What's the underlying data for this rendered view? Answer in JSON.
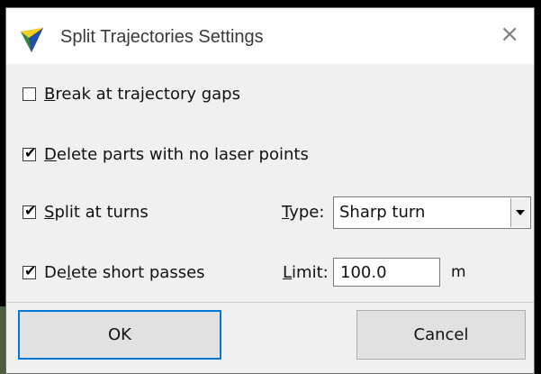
{
  "window": {
    "title": "Split Trajectories Settings",
    "close_glyph": "×",
    "icon": "app-logo-icon"
  },
  "options": [
    {
      "pre": "",
      "mnemonic": "B",
      "post": "reak at trajectory gaps",
      "checked": false
    },
    {
      "pre": "",
      "mnemonic": "D",
      "post": "elete parts with no laser points",
      "checked": true
    },
    {
      "pre": "",
      "mnemonic": "S",
      "post": "plit at turns",
      "checked": true
    },
    {
      "pre": "De",
      "mnemonic": "l",
      "post": "ete short passes",
      "checked": true
    }
  ],
  "type_field": {
    "mnemonic": "T",
    "post": "ype:",
    "value": "Sharp turn"
  },
  "limit_field": {
    "mnemonic": "L",
    "post": "imit:",
    "value": "100.0",
    "unit": "m"
  },
  "buttons": {
    "ok": "OK",
    "cancel": "Cancel"
  },
  "colors": {
    "focus": "#0078d7",
    "dialog_bg": "#f0f0f0"
  }
}
